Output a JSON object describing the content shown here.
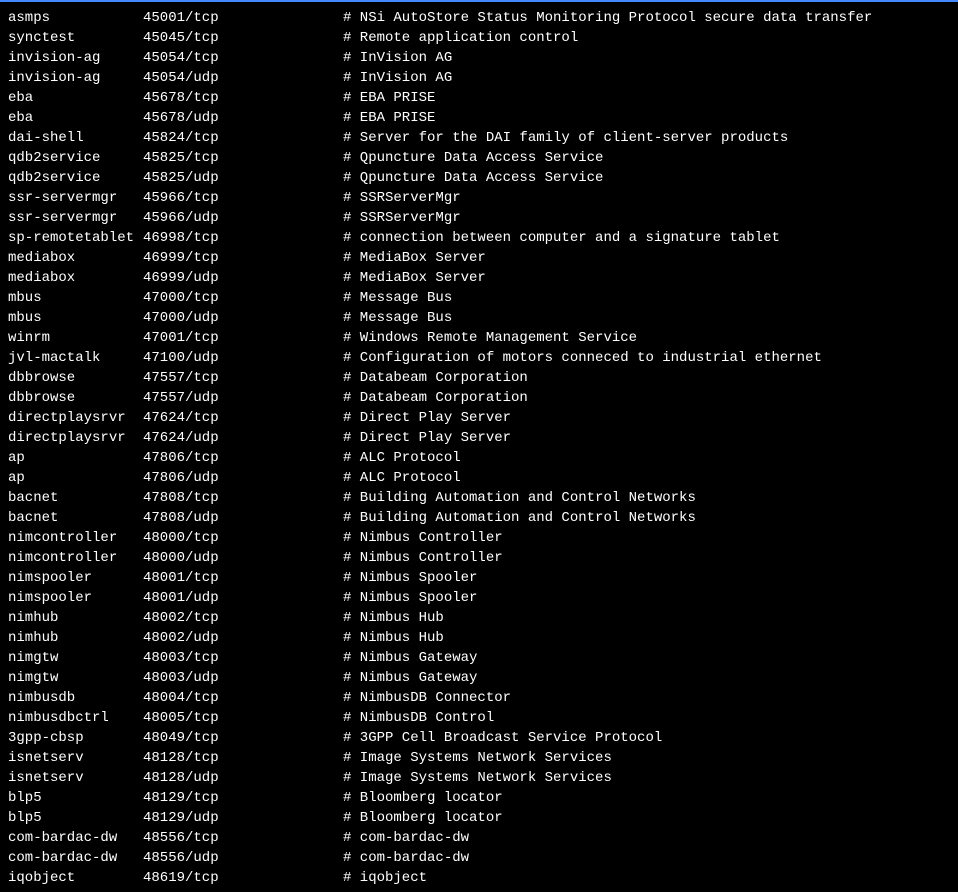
{
  "entries": [
    {
      "service": "asmps",
      "port": "45001/tcp",
      "desc": "# NSi AutoStore Status Monitoring Protocol secure data transfer"
    },
    {
      "service": "synctest",
      "port": "45045/tcp",
      "desc": "# Remote application control"
    },
    {
      "service": "invision-ag",
      "port": "45054/tcp",
      "desc": "# InVision AG"
    },
    {
      "service": "invision-ag",
      "port": "45054/udp",
      "desc": "# InVision AG"
    },
    {
      "service": "eba",
      "port": "45678/tcp",
      "desc": "# EBA PRISE"
    },
    {
      "service": "eba",
      "port": "45678/udp",
      "desc": "# EBA PRISE"
    },
    {
      "service": "dai-shell",
      "port": "45824/tcp",
      "desc": "# Server for the DAI family of client-server products"
    },
    {
      "service": "qdb2service",
      "port": "45825/tcp",
      "desc": "# Qpuncture Data Access Service"
    },
    {
      "service": "qdb2service",
      "port": "45825/udp",
      "desc": "# Qpuncture Data Access Service"
    },
    {
      "service": "ssr-servermgr",
      "port": "45966/tcp",
      "desc": "# SSRServerMgr"
    },
    {
      "service": "ssr-servermgr",
      "port": "45966/udp",
      "desc": "# SSRServerMgr"
    },
    {
      "service": "sp-remotetablet",
      "port": "46998/tcp",
      "desc": "# connection between computer and a signature tablet"
    },
    {
      "service": "mediabox",
      "port": "46999/tcp",
      "desc": "# MediaBox Server"
    },
    {
      "service": "mediabox",
      "port": "46999/udp",
      "desc": "# MediaBox Server"
    },
    {
      "service": "mbus",
      "port": "47000/tcp",
      "desc": "# Message Bus"
    },
    {
      "service": "mbus",
      "port": "47000/udp",
      "desc": "# Message Bus"
    },
    {
      "service": "winrm",
      "port": "47001/tcp",
      "desc": "# Windows Remote Management Service"
    },
    {
      "service": "jvl-mactalk",
      "port": "47100/udp",
      "desc": "# Configuration of motors conneced to industrial ethernet"
    },
    {
      "service": "dbbrowse",
      "port": "47557/tcp",
      "desc": "# Databeam Corporation"
    },
    {
      "service": "dbbrowse",
      "port": "47557/udp",
      "desc": "# Databeam Corporation"
    },
    {
      "service": "directplaysrvr",
      "port": "47624/tcp",
      "desc": "# Direct Play Server"
    },
    {
      "service": "directplaysrvr",
      "port": "47624/udp",
      "desc": "# Direct Play Server"
    },
    {
      "service": "ap",
      "port": "47806/tcp",
      "desc": "# ALC Protocol"
    },
    {
      "service": "ap",
      "port": "47806/udp",
      "desc": "# ALC Protocol"
    },
    {
      "service": "bacnet",
      "port": "47808/tcp",
      "desc": "# Building Automation and Control Networks"
    },
    {
      "service": "bacnet",
      "port": "47808/udp",
      "desc": "# Building Automation and Control Networks"
    },
    {
      "service": "nimcontroller",
      "port": "48000/tcp",
      "desc": "# Nimbus Controller"
    },
    {
      "service": "nimcontroller",
      "port": "48000/udp",
      "desc": "# Nimbus Controller"
    },
    {
      "service": "nimspooler",
      "port": "48001/tcp",
      "desc": "# Nimbus Spooler"
    },
    {
      "service": "nimspooler",
      "port": "48001/udp",
      "desc": "# Nimbus Spooler"
    },
    {
      "service": "nimhub",
      "port": "48002/tcp",
      "desc": "# Nimbus Hub"
    },
    {
      "service": "nimhub",
      "port": "48002/udp",
      "desc": "# Nimbus Hub"
    },
    {
      "service": "nimgtw",
      "port": "48003/tcp",
      "desc": "# Nimbus Gateway"
    },
    {
      "service": "nimgtw",
      "port": "48003/udp",
      "desc": "# Nimbus Gateway"
    },
    {
      "service": "nimbusdb",
      "port": "48004/tcp",
      "desc": "# NimbusDB Connector"
    },
    {
      "service": "nimbusdbctrl",
      "port": "48005/tcp",
      "desc": "# NimbusDB Control"
    },
    {
      "service": "3gpp-cbsp",
      "port": "48049/tcp",
      "desc": "# 3GPP Cell Broadcast Service Protocol"
    },
    {
      "service": "isnetserv",
      "port": "48128/tcp",
      "desc": "# Image Systems Network Services"
    },
    {
      "service": "isnetserv",
      "port": "48128/udp",
      "desc": "# Image Systems Network Services"
    },
    {
      "service": "blp5",
      "port": "48129/tcp",
      "desc": "# Bloomberg locator"
    },
    {
      "service": "blp5",
      "port": "48129/udp",
      "desc": "# Bloomberg locator"
    },
    {
      "service": "com-bardac-dw",
      "port": "48556/tcp",
      "desc": "# com-bardac-dw"
    },
    {
      "service": "com-bardac-dw",
      "port": "48556/udp",
      "desc": "# com-bardac-dw"
    },
    {
      "service": "iqobject",
      "port": "48619/tcp",
      "desc": "# iqobject"
    }
  ]
}
